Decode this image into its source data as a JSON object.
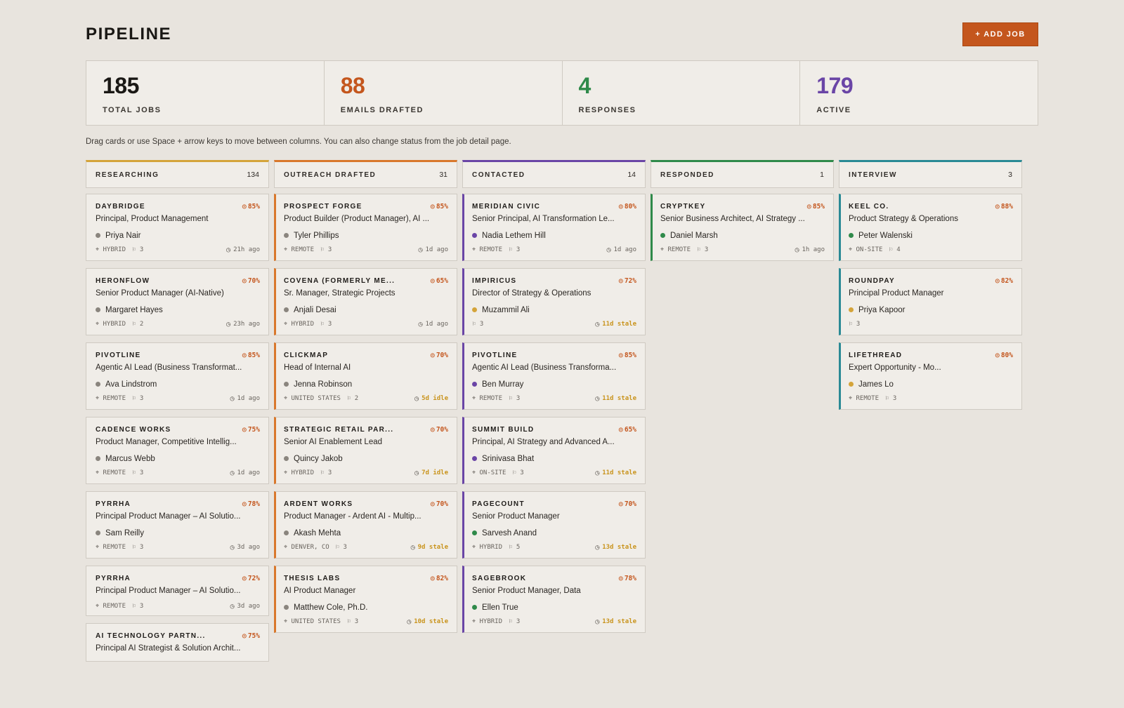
{
  "header": {
    "title": "PIPELINE",
    "add_label": "+ ADD JOB"
  },
  "stats": [
    {
      "value": "185",
      "label": "TOTAL JOBS",
      "color": "#1a1815"
    },
    {
      "value": "88",
      "label": "EMAILS DRAFTED",
      "color": "#c4561d"
    },
    {
      "value": "4",
      "label": "RESPONSES",
      "color": "#2f8a4a"
    },
    {
      "value": "179",
      "label": "ACTIVE",
      "color": "#6a45a6"
    }
  ],
  "hint": "Drag cards or use Space + arrow keys to move between columns. You can also change status from the job detail page.",
  "colors": {
    "accent": "#c4561d",
    "researching": "#d4a43a",
    "outreach": "#d9782c",
    "contacted": "#6a45a6",
    "responded": "#2f8a4a",
    "interview": "#2a8a95",
    "dot_gray": "#8a857e",
    "dot_purple": "#6a45a6",
    "dot_green": "#2f8a4a",
    "dot_yellow": "#d4a43a",
    "warn": "#c9941d"
  },
  "columns": [
    {
      "name": "RESEARCHING",
      "count": "134",
      "color": "#d4a43a",
      "card_border": "neutral",
      "cards": [
        {
          "company": "DAYBRIDGE",
          "score": "85%",
          "role": "Principal, Product Management",
          "contact": "Priya Nair",
          "dot": "#8a857e",
          "location": "HYBRID",
          "contacts": "3",
          "time": "21h ago",
          "warn": false
        },
        {
          "company": "HERONFLOW",
          "score": "70%",
          "role": "Senior Product Manager (AI-Native)",
          "contact": "Margaret Hayes",
          "dot": "#8a857e",
          "location": "HYBRID",
          "contacts": "2",
          "time": "23h ago",
          "warn": false
        },
        {
          "company": "PIVOTLINE",
          "score": "85%",
          "role": "Agentic AI Lead (Business Transformat...",
          "contact": "Ava Lindstrom",
          "dot": "#8a857e",
          "location": "REMOTE",
          "contacts": "3",
          "time": "1d ago",
          "warn": false
        },
        {
          "company": "CADENCE WORKS",
          "score": "75%",
          "role": "Product Manager, Competitive Intellig...",
          "contact": "Marcus Webb",
          "dot": "#8a857e",
          "location": "REMOTE",
          "contacts": "3",
          "time": "1d ago",
          "warn": false
        },
        {
          "company": "PYRRHA",
          "score": "78%",
          "role": "Principal Product Manager – AI Solutio...",
          "contact": "Sam Reilly",
          "dot": "#8a857e",
          "location": "REMOTE",
          "contacts": "3",
          "time": "3d ago",
          "warn": false
        },
        {
          "company": "PYRRHA",
          "score": "72%",
          "role": "Principal Product Manager – AI Solutio...",
          "contact": "",
          "dot": "",
          "location": "REMOTE",
          "contacts": "3",
          "time": "3d ago",
          "warn": false
        },
        {
          "company": "AI TECHNOLOGY PARTN...",
          "score": "75%",
          "role": "Principal AI Strategist & Solution Archit...",
          "contact": "",
          "dot": "",
          "location": "",
          "contacts": "",
          "time": "",
          "warn": false
        }
      ]
    },
    {
      "name": "OUTREACH DRAFTED",
      "count": "31",
      "color": "#d9782c",
      "card_border": "#d9782c",
      "cards": [
        {
          "company": "PROSPECT FORGE",
          "score": "85%",
          "role": "Product Builder (Product Manager), AI ...",
          "contact": "Tyler Phillips",
          "dot": "#8a857e",
          "location": "REMOTE",
          "contacts": "3",
          "time": "1d ago",
          "warn": false
        },
        {
          "company": "COVENA (FORMERLY ME...",
          "score": "65%",
          "role": "Sr. Manager, Strategic Projects",
          "contact": "Anjali Desai",
          "dot": "#8a857e",
          "location": "HYBRID",
          "contacts": "3",
          "time": "1d ago",
          "warn": false
        },
        {
          "company": "CLICKMAP",
          "score": "70%",
          "role": "Head of Internal AI",
          "contact": "Jenna Robinson",
          "dot": "#8a857e",
          "location": "UNITED STATES",
          "contacts": "2",
          "time": "5d idle",
          "warn": true
        },
        {
          "company": "STRATEGIC RETAIL PAR...",
          "score": "70%",
          "role": "Senior AI Enablement Lead",
          "contact": "Quincy Jakob",
          "dot": "#8a857e",
          "location": "HYBRID",
          "contacts": "3",
          "time": "7d idle",
          "warn": true
        },
        {
          "company": "ARDENT WORKS",
          "score": "70%",
          "role": "Product Manager - Ardent AI - Multip...",
          "contact": "Akash Mehta",
          "dot": "#8a857e",
          "location": "DENVER, CO",
          "contacts": "3",
          "time": "9d stale",
          "warn": true
        },
        {
          "company": "THESIS LABS",
          "score": "82%",
          "role": "AI Product Manager",
          "contact": "Matthew Cole, Ph.D.",
          "dot": "#8a857e",
          "location": "UNITED STATES",
          "contacts": "3",
          "time": "10d stale",
          "warn": true
        }
      ]
    },
    {
      "name": "CONTACTED",
      "count": "14",
      "color": "#6a45a6",
      "card_border": "#6a45a6",
      "cards": [
        {
          "company": "MERIDIAN CIVIC",
          "score": "80%",
          "role": "Senior Principal, AI Transformation Le...",
          "contact": "Nadia Lethem Hill",
          "dot": "#6a45a6",
          "location": "REMOTE",
          "contacts": "3",
          "time": "1d ago",
          "warn": false
        },
        {
          "company": "IMPIRICUS",
          "score": "72%",
          "role": "Director of Strategy & Operations",
          "contact": "Muzammil Ali",
          "dot": "#d4a43a",
          "location": "",
          "contacts": "3",
          "time": "11d stale",
          "warn": true
        },
        {
          "company": "PIVOTLINE",
          "score": "85%",
          "role": "Agentic AI Lead (Business Transforma...",
          "contact": "Ben Murray",
          "dot": "#6a45a6",
          "location": "REMOTE",
          "contacts": "3",
          "time": "11d stale",
          "warn": true
        },
        {
          "company": "SUMMIT BUILD",
          "score": "65%",
          "role": "Principal, AI Strategy and Advanced A...",
          "contact": "Srinivasa Bhat",
          "dot": "#6a45a6",
          "location": "ON-SITE",
          "contacts": "3",
          "time": "11d stale",
          "warn": true
        },
        {
          "company": "PAGECOUNT",
          "score": "70%",
          "role": "Senior Product Manager",
          "contact": "Sarvesh Anand",
          "dot": "#2f8a4a",
          "location": "HYBRID",
          "contacts": "5",
          "time": "13d stale",
          "warn": true
        },
        {
          "company": "SAGEBROOK",
          "score": "78%",
          "role": "Senior Product Manager, Data",
          "contact": "Ellen True",
          "dot": "#2f8a4a",
          "location": "HYBRID",
          "contacts": "3",
          "time": "13d stale",
          "warn": true
        }
      ]
    },
    {
      "name": "RESPONDED",
      "count": "1",
      "color": "#2f8a4a",
      "card_border": "#2f8a4a",
      "cards": [
        {
          "company": "CRYPTKEY",
          "score": "85%",
          "role": "Senior Business Architect, AI Strategy ...",
          "contact": "Daniel Marsh",
          "dot": "#2f8a4a",
          "location": "REMOTE",
          "contacts": "3",
          "time": "1h ago",
          "warn": false
        }
      ]
    },
    {
      "name": "INTERVIEW",
      "count": "3",
      "color": "#2a8a95",
      "card_border": "#2a8a95",
      "cards": [
        {
          "company": "KEEL CO.",
          "score": "88%",
          "role": "Product Strategy & Operations",
          "contact": "Peter Walenski",
          "dot": "#2f8a4a",
          "location": "ON-SITE",
          "contacts": "4",
          "time": "",
          "warn": false
        },
        {
          "company": "ROUNDPAY",
          "score": "82%",
          "role": "Principal Product Manager",
          "contact": "Priya Kapoor",
          "dot": "#d4a43a",
          "location": "",
          "contacts": "3",
          "time": "",
          "warn": false
        },
        {
          "company": "LIFETHREAD",
          "score": "80%",
          "role": "Expert Opportunity - Mo...",
          "contact": "James Lo",
          "dot": "#d4a43a",
          "location": "REMOTE",
          "contacts": "3",
          "time": "",
          "warn": false
        }
      ]
    }
  ]
}
